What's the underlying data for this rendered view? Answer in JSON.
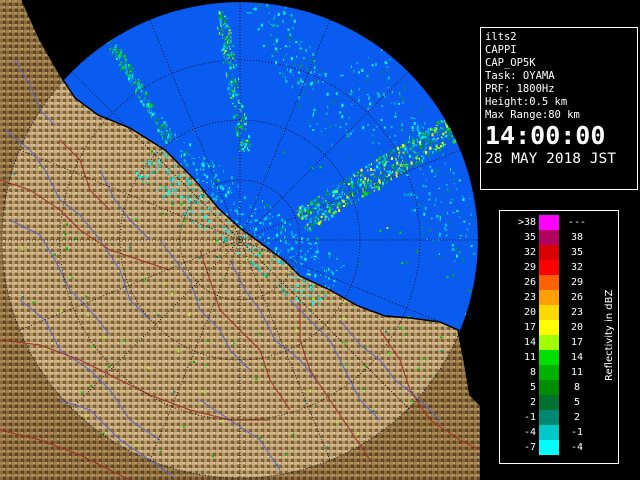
{
  "info": {
    "station": "ilts2",
    "product": "CAPPI",
    "scan": "CAP_OP5K",
    "task": "Task: OYAMA",
    "prf": "PRF: 1800Hz",
    "height": "Height:0.5 km",
    "max_range": "Max Range:80 km",
    "time": "14:00:00",
    "date": "28 MAY 2018 JST"
  },
  "legend": {
    "title": "Reflectivity in dBZ",
    "rows": [
      {
        "lo": ">38",
        "hi": "---",
        "color": "#ff00ff"
      },
      {
        "lo": "35",
        "hi": "38",
        "color": "#b00060"
      },
      {
        "lo": "32",
        "hi": "35",
        "color": "#d80000"
      },
      {
        "lo": "29",
        "hi": "32",
        "color": "#ff0000"
      },
      {
        "lo": "26",
        "hi": "29",
        "color": "#ff6000"
      },
      {
        "lo": "23",
        "hi": "26",
        "color": "#ffa000"
      },
      {
        "lo": "20",
        "hi": "23",
        "color": "#ffd800"
      },
      {
        "lo": "17",
        "hi": "20",
        "color": "#ffff00"
      },
      {
        "lo": "14",
        "hi": "17",
        "color": "#a0ff00"
      },
      {
        "lo": "11",
        "hi": "14",
        "color": "#00e000"
      },
      {
        "lo": "8",
        "hi": "11",
        "color": "#00b000"
      },
      {
        "lo": "5",
        "hi": "8",
        "color": "#008c00"
      },
      {
        "lo": "2",
        "hi": "5",
        "color": "#007030"
      },
      {
        "lo": "-1",
        "hi": "2",
        "color": "#008870"
      },
      {
        "lo": "-4",
        "hi": "-1",
        "color": "#00c8c8"
      },
      {
        "lo": "-7",
        "hi": "-4",
        "color": "#00ffff"
      }
    ]
  },
  "colors": {
    "radar_background": "#0a5cf0",
    "land": "#8a6a3c",
    "river": "#5a64c8",
    "boundary": "#a0302a",
    "range_ring": "#000000"
  }
}
